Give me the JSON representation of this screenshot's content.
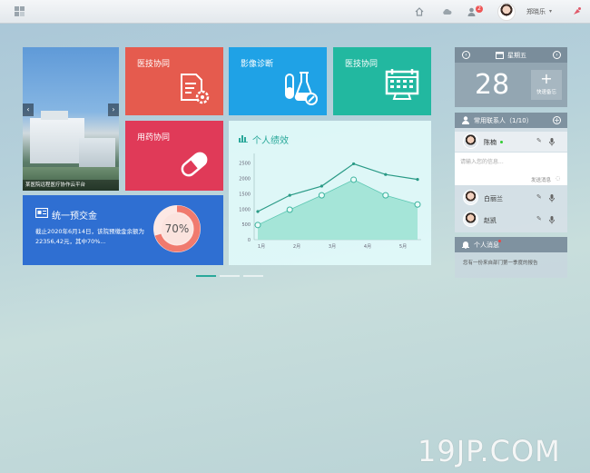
{
  "topbar": {
    "username": "郑晓乐",
    "notification_count": "2"
  },
  "tiles": [
    {
      "label": "医技协同",
      "color": "#e55b4e"
    },
    {
      "label": "影像诊断",
      "color": "#1fa2e6"
    },
    {
      "label": "医技协同",
      "color": "#22b8a0"
    },
    {
      "label": "用药协同",
      "color": "#e03a58"
    }
  ],
  "carousel": {
    "caption": "某医院远程医疗协作云平台"
  },
  "performance": {
    "title": "个人绩效"
  },
  "deposit": {
    "title": "统一预交金",
    "text": "截止2020年6月14日，该院预缴金余额为22356,42元，其中70%...",
    "percent_label": "70%",
    "percent": 70
  },
  "chart_data": {
    "type": "area",
    "title": "个人绩效",
    "xlabel": "",
    "ylabel": "",
    "categories": [
      "1月",
      "2月",
      "3月",
      "4月",
      "5月"
    ],
    "x_ticks": [
      "1月",
      "2月",
      "3月",
      "4月",
      "5月"
    ],
    "y_ticks": [
      "0",
      "500",
      "1000",
      "1500",
      "2000",
      "2500"
    ],
    "ylim": [
      0,
      2700
    ],
    "series": [
      {
        "name": "",
        "type": "line",
        "color": "#2a9a86",
        "values": [
          920,
          1450,
          1750,
          2480,
          2130,
          1970
        ]
      },
      {
        "name": "",
        "type": "area",
        "color": "#9fe2d4",
        "values": [
          480,
          980,
          1450,
          1960,
          1450,
          1150
        ]
      }
    ],
    "grid": false,
    "legend": "none"
  },
  "calendar": {
    "weekday": "星期五",
    "day": "28",
    "quick_note_label": "快速备忘"
  },
  "contacts": {
    "title": "常用联系人（1/10）",
    "items": [
      {
        "name": "陈楠",
        "online": true
      },
      {
        "name": "白丽兰",
        "online": false
      },
      {
        "name": "赵凯",
        "online": false
      }
    ],
    "message_placeholder": "请输入您的信息...",
    "send_label": "发送消息"
  },
  "messages": {
    "title": "个人消息",
    "items": [
      "您有一份来自部门第一季度的报告"
    ]
  },
  "watermark": "19JP.COM",
  "colors": {
    "red_tile": "#e55b4e",
    "blue_tile": "#1fa2e6",
    "teal_tile": "#22b8a0",
    "pink_tile": "#e03a58",
    "deposit": "#2f6fd2",
    "ring": "#f07a6e"
  }
}
